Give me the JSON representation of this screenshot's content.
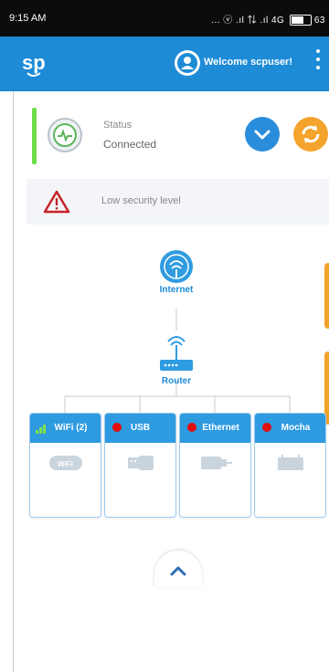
{
  "statusbar": {
    "time": "9:15 AM",
    "indicators": "... ⓥ .ıl ⇅ .ıl 4G",
    "battery": "63"
  },
  "appbar": {
    "logo_icon": "sp-logo-icon",
    "welcome": "Welcome  scpuser!",
    "menu_icon": "kebab-menu-icon",
    "color": "#1d8bd6"
  },
  "status": {
    "label": "Status",
    "value": "Connected",
    "indicator_color": "#6fdc4a"
  },
  "actions": {
    "expand_icon": "chevron-down-icon",
    "refresh_icon": "refresh-icon",
    "expand_color": "#2a8ddb",
    "refresh_color": "#f4a32c"
  },
  "alert": {
    "icon": "warning-triangle-icon",
    "text": "Low security level"
  },
  "topology": {
    "internet": {
      "label": "Internet",
      "icon": "globe-icon"
    },
    "router": {
      "label": "Router",
      "icon": "router-icon"
    },
    "ports": [
      {
        "label": "WiFi (2)",
        "status": "signal",
        "icon": "wifi-card-icon"
      },
      {
        "label": "USB",
        "status": "inactive",
        "icon": "usb-icon"
      },
      {
        "label": "Ethernet",
        "status": "inactive",
        "icon": "ethernet-icon"
      },
      {
        "label": "Mocha",
        "status": "inactive",
        "icon": "coax-icon"
      }
    ]
  },
  "footer": {
    "collapse_icon": "chevron-up-icon"
  }
}
